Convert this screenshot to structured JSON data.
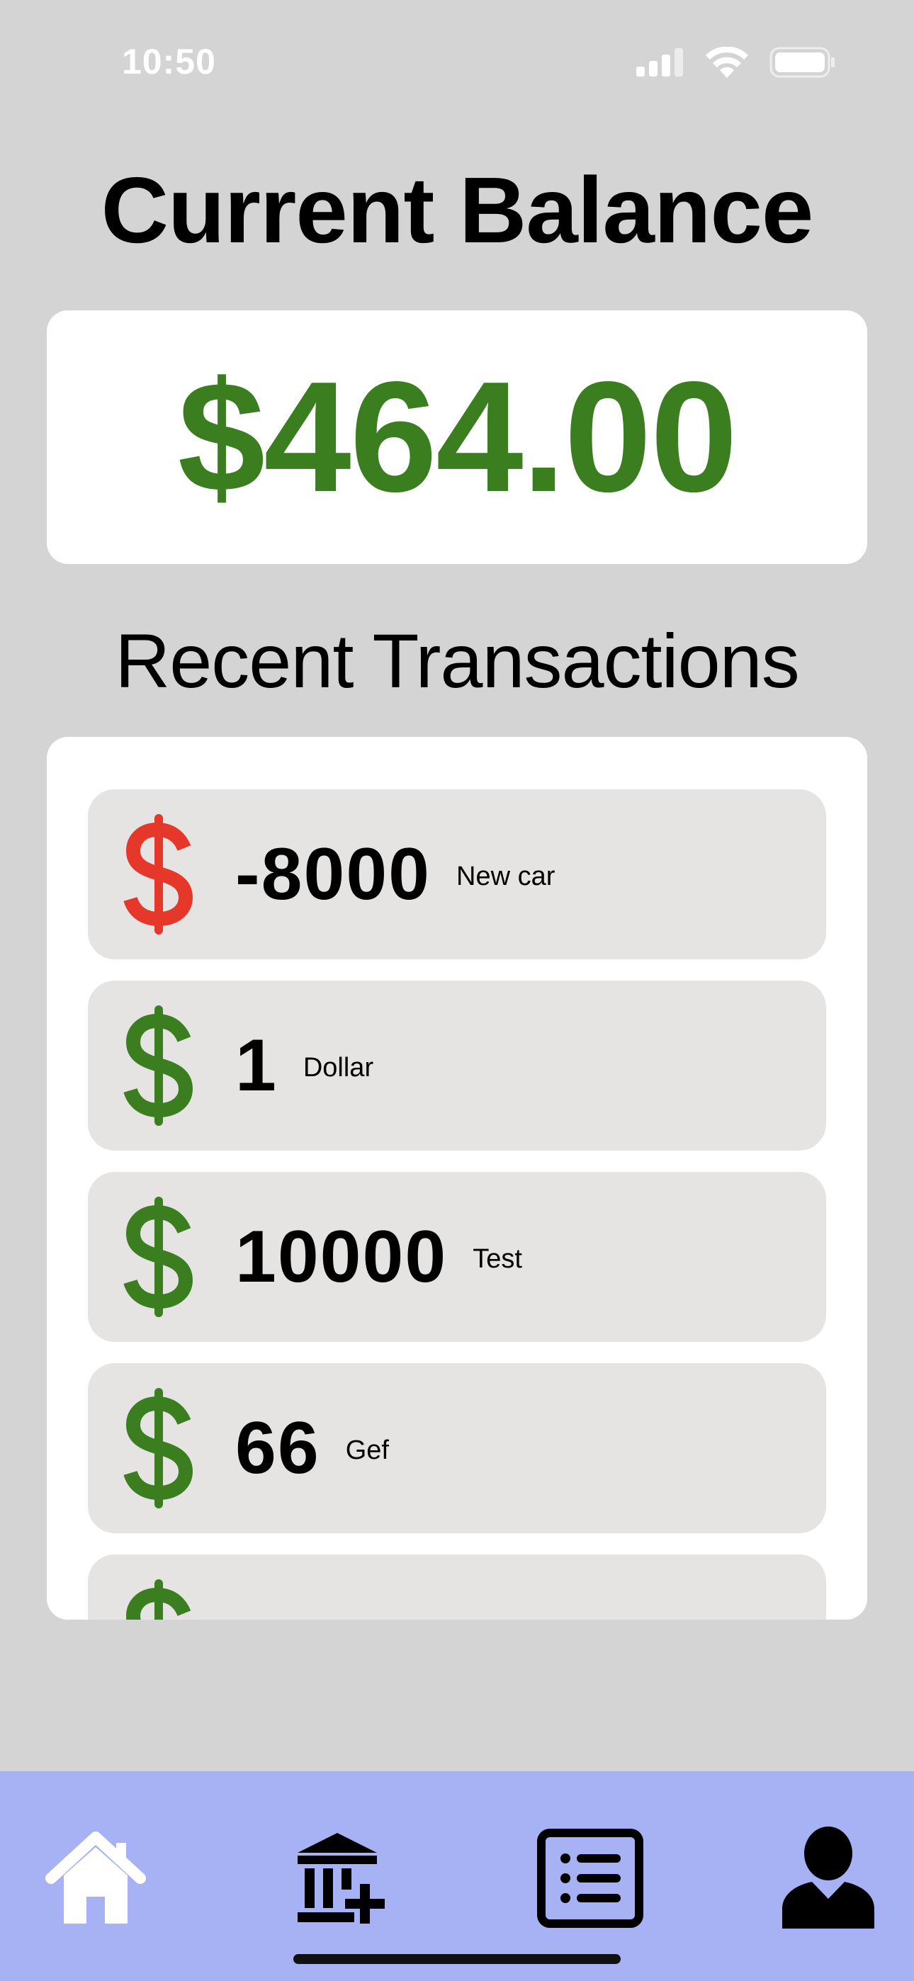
{
  "status_bar": {
    "time": "10:50"
  },
  "balance": {
    "title": "Current Balance",
    "amount": "$464.00"
  },
  "transactions": {
    "title": "Recent Transactions",
    "items": [
      {
        "amount": "-8000",
        "description": "New car",
        "type": "debit"
      },
      {
        "amount": "1",
        "description": "Dollar",
        "type": "credit"
      },
      {
        "amount": "10000",
        "description": "Test",
        "type": "credit"
      },
      {
        "amount": "66",
        "description": "Gef",
        "type": "credit"
      }
    ]
  },
  "colors": {
    "background": "#d4d4d4",
    "credit": "#3a7e1f",
    "debit": "#e5372a",
    "tab_bar": "#a7b2f4",
    "transaction_row": "#e5e4e3"
  },
  "tabs": [
    {
      "icon": "home-icon",
      "active": true
    },
    {
      "icon": "bank-add-icon",
      "active": false
    },
    {
      "icon": "list-icon",
      "active": false
    },
    {
      "icon": "profile-icon",
      "active": false
    }
  ]
}
